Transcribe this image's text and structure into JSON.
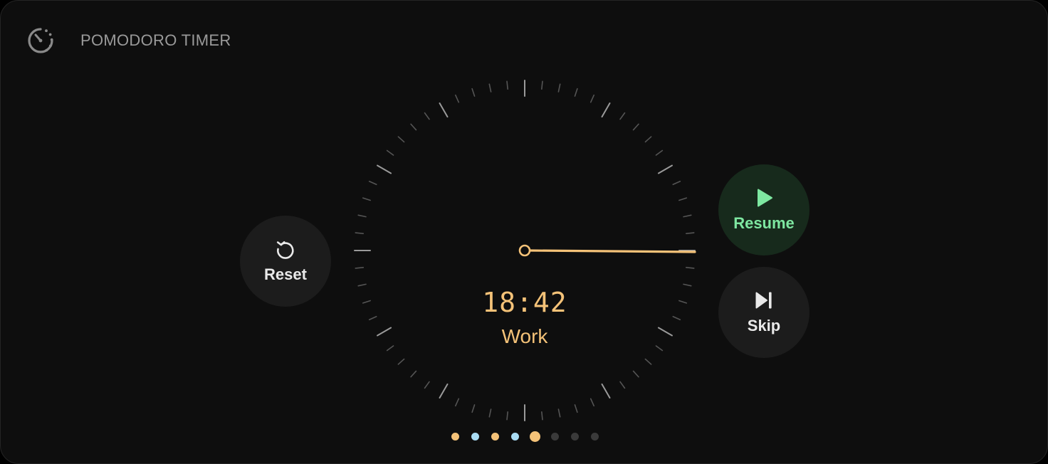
{
  "app": {
    "title": "POMODORO TIMER",
    "icon": "timer-icon"
  },
  "timer": {
    "time_display": "18:42",
    "phase_label": "Work",
    "accent_color": "#f4c278"
  },
  "controls": {
    "reset_label": "Reset",
    "resume_label": "Resume",
    "skip_label": "Skip",
    "reset_icon": "reset-icon",
    "resume_icon": "play-icon",
    "skip_icon": "skip-forward-icon",
    "resume_color": "#7ee7a1"
  },
  "sessions": [
    {
      "type": "work",
      "color": "#f4c278",
      "state": "done"
    },
    {
      "type": "break",
      "color": "#a9dcf4",
      "state": "done"
    },
    {
      "type": "work",
      "color": "#f4c278",
      "state": "done"
    },
    {
      "type": "break",
      "color": "#a9dcf4",
      "state": "done"
    },
    {
      "type": "work",
      "color": "#f4c278",
      "state": "current"
    },
    {
      "type": "pending",
      "color": "#3a3a3a",
      "state": "upcoming"
    },
    {
      "type": "pending",
      "color": "#3a3a3a",
      "state": "upcoming"
    },
    {
      "type": "pending",
      "color": "#3a3a3a",
      "state": "upcoming"
    }
  ]
}
